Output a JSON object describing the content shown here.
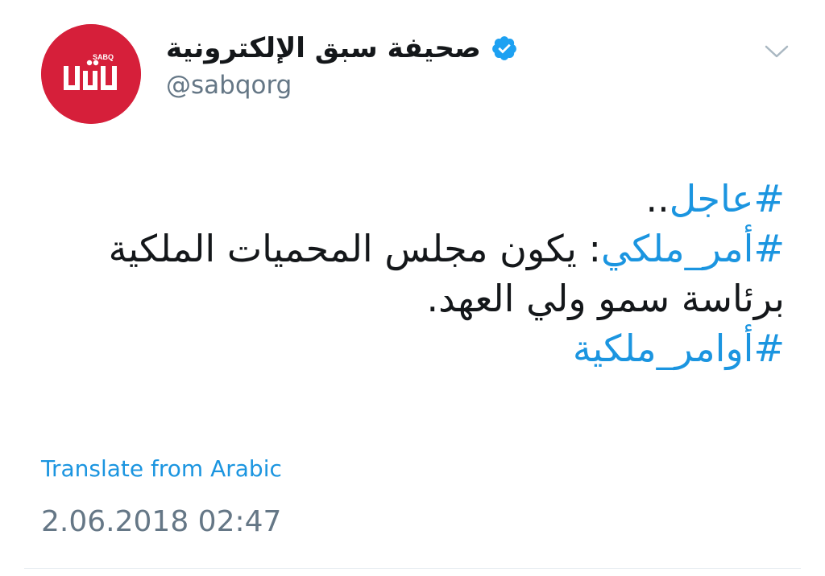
{
  "author": {
    "display_name": "صحيفة سبق الإلكترونية",
    "handle": "@sabqorg",
    "verified": true,
    "avatar": {
      "icon": "sabq-logo",
      "background_color": "#d61f3a",
      "logo_text": "SABQ"
    }
  },
  "tweet": {
    "lines": [
      {
        "hashtag": "#عاجل",
        "text": ".."
      },
      {
        "hashtag": "#أمر_ملكي",
        "text": ": يكون مجلس المحميات الملكية"
      },
      {
        "hashtag": "",
        "text": "برئاسة سمو ولي العهد."
      },
      {
        "hashtag": "#أوامر_ملكية",
        "text": ""
      }
    ],
    "translate_label": "Translate from Arabic",
    "timestamp": "2.06.2018 02:47"
  },
  "colors": {
    "link": "#1b95e0",
    "text": "#14171a",
    "muted": "#657786",
    "verified": "#1da1f2"
  },
  "icons": {
    "verified": "verified-badge-icon",
    "menu": "chevron-down-icon"
  }
}
